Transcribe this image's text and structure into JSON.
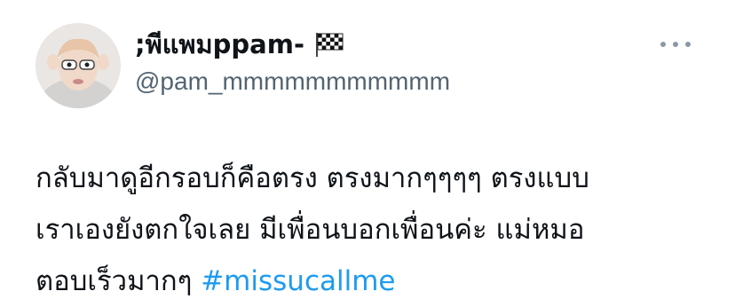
{
  "tweet": {
    "display_name": ";พีแพมppam-",
    "handle": "@pam_mmmmmmmmmmm",
    "flag_icon": "checkered-flag-icon",
    "more_icon": "more-options-icon",
    "body": {
      "line1": "กลับมาดูอีกรอบก็คือตรง ตรงมากๆๆๆๆ ตรงแบบ",
      "line2": "เราเองยังตกใจเลย มีเพื่อนบอกเพื่อนค่ะ แม่หมอ",
      "line3_text": "ตอบเร็วมากๆ ",
      "hashtag": "#missucallme"
    },
    "colors": {
      "text": "#0f1419",
      "secondary": "#536471",
      "link": "#1d9bf0"
    }
  }
}
